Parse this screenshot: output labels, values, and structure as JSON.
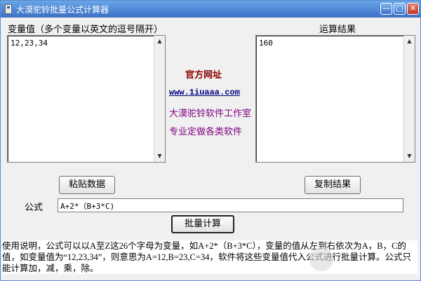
{
  "window": {
    "title": "大漠驼铃批量公式计算器",
    "controls": [
      "—",
      "□",
      "✕"
    ]
  },
  "variables": {
    "label": "变量值（多个变量以英文的逗号隔开）",
    "value": "12,23,34"
  },
  "results": {
    "label": "运算结果",
    "value": "160"
  },
  "center_info": {
    "official_site_label": "官方网址",
    "site_url": "www.1iuaaa.com",
    "studio": "大漠驼铃软件工作室",
    "tagline": "专业定做各类软件"
  },
  "buttons": {
    "paste": "粘贴数据",
    "copy": "复制结果",
    "calculate": "批量计算"
  },
  "formula": {
    "label": "公式",
    "value": "A+2*（B+3*C)"
  },
  "help": {
    "text": "使用说明，公式可以以A至Z这26个字母为变量，如A+2*（B+3*C），变量的值从左到右依次为A，B，C的值，如变量值为“12,23,34”，则意思为A=12,B=23,C=34，软件将这些变量值代入公式进行批量计算。公式只能计算加，减，乘，除。"
  },
  "colors": {
    "official_site": "#8b0000",
    "url": "#000080",
    "studio": "#800080",
    "tagline": "#800080"
  }
}
